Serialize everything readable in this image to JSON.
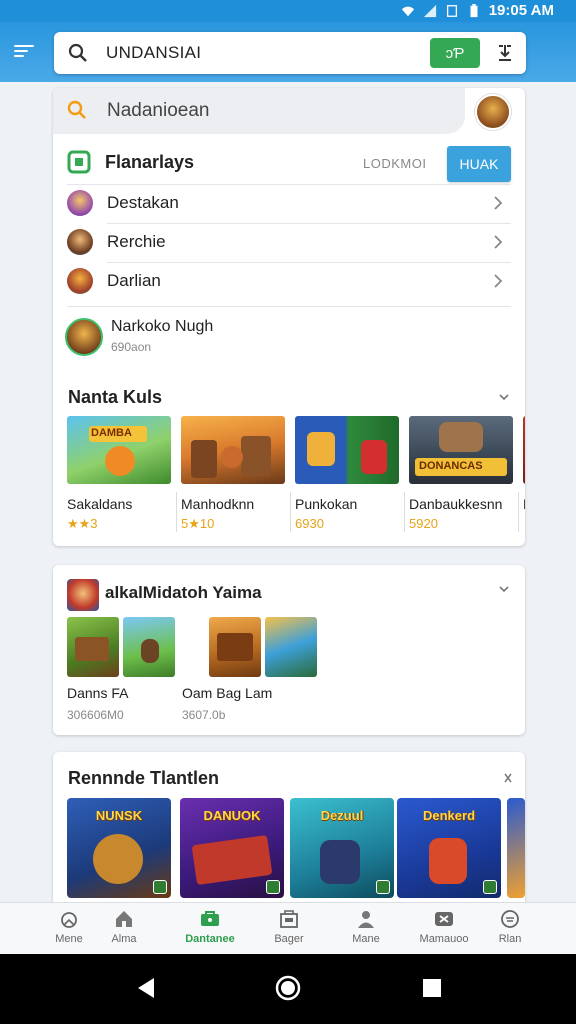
{
  "status_bar": {
    "time": "19:05 AM"
  },
  "header": {
    "search_query": "UNDANSIAI",
    "voice_button_label": "ↄƤ"
  },
  "panel": {
    "search_placeholder": "Nadanioean",
    "featured": {
      "title": "Flanarlays",
      "meta": "LODKMOI",
      "button_label": "HUAK"
    },
    "list_items": [
      {
        "label": "Destakan"
      },
      {
        "label": "Rerchie"
      },
      {
        "label": "Darlian"
      }
    ],
    "user": {
      "name": "Narkoko Nugh",
      "subtitle": "690aon"
    },
    "section_title": "Nanta Kuls",
    "games": [
      {
        "name": "Sakaldans",
        "rating": "★★3",
        "thumb_label": "DAMBA"
      },
      {
        "name": "Manhodknn",
        "rating": "5★10",
        "thumb_label": ""
      },
      {
        "name": "Punkokan",
        "rating": "6930",
        "thumb_label": ""
      },
      {
        "name": "Danbaukkesnn",
        "rating": "5920",
        "thumb_label": "DONANCAS"
      },
      {
        "name": "N",
        "rating": "",
        "thumb_label": ""
      }
    ]
  },
  "panel2": {
    "title": "alkalMidatoh Yaima",
    "items": [
      {
        "name": "Danns FA",
        "meta": "306606M0"
      },
      {
        "name": "Oam Bag Lam",
        "meta": "3607.0b"
      }
    ]
  },
  "panel3": {
    "title": "Rennnde Tlantlen",
    "games": [
      {
        "label": "NUNSK"
      },
      {
        "label": "DANUOK"
      },
      {
        "label": "Dezuul"
      },
      {
        "label": "Denkerd"
      },
      {
        "label": ""
      }
    ]
  },
  "bottom_nav": [
    {
      "label": "Mene",
      "icon": "home-outline-icon"
    },
    {
      "label": "Alma",
      "icon": "house-icon"
    },
    {
      "label": "Dantanee",
      "icon": "store-icon",
      "active": true
    },
    {
      "label": "Bager",
      "icon": "bag-icon"
    },
    {
      "label": "Mane",
      "icon": "person-icon"
    },
    {
      "label": "Mamauoo",
      "icon": "gamepad-icon"
    },
    {
      "label": "Rlan",
      "icon": "circle-icon"
    }
  ],
  "colors": {
    "primary": "#1e8fd8",
    "accent_green": "#34a853",
    "active_tab": "#2e9e4f",
    "rating": "#e8a317"
  }
}
